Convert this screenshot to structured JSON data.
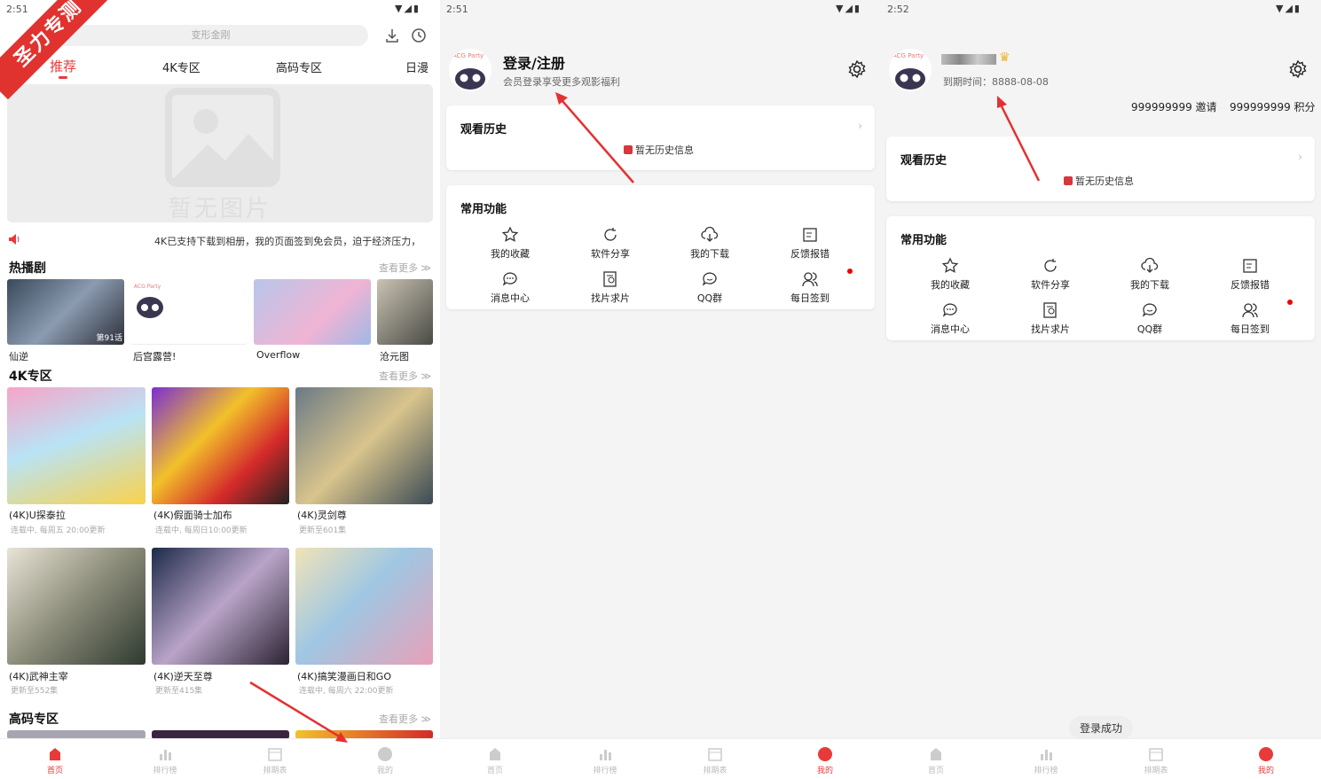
{
  "watermark": "圣力专测",
  "home": {
    "status_time": "2:51",
    "search_placeholder": "变形金刚",
    "tabs": [
      "推荐",
      "4K专区",
      "高码专区",
      "日漫"
    ],
    "banner_placeholder": "暂无图片",
    "notice": "4K已支持下载到相册，我的页面签到免会员，迫于经济压力，",
    "hot": {
      "title": "热播剧",
      "more": "查看更多",
      "items": [
        {
          "title": "仙逆",
          "badge": "第91话"
        },
        {
          "title": "后宫露营!",
          "badge": ""
        },
        {
          "title": "Overflow",
          "badge": ""
        },
        {
          "title": "沧元图",
          "badge": ""
        }
      ]
    },
    "k4": {
      "title": "4K专区",
      "more": "查看更多",
      "items": [
        {
          "title": "(4K)U探泰拉",
          "sub": "连载中, 每周五 20:00更新"
        },
        {
          "title": "(4K)假面骑士加布",
          "sub": "连载中, 每周日10:00更新"
        },
        {
          "title": "(4K)灵剑尊",
          "sub": "更新至601集"
        },
        {
          "title": "(4K)武神主宰",
          "sub": "更新至552集"
        },
        {
          "title": "(4K)逆天至尊",
          "sub": "更新至415集"
        },
        {
          "title": "(4K)搞笑漫画日和GO",
          "sub": "连载中, 每周六 22:00更新"
        }
      ]
    },
    "hq": {
      "title": "高码专区",
      "more": "查看更多"
    }
  },
  "tabbar": [
    "首页",
    "排行榜",
    "排期表",
    "我的"
  ],
  "profile_guest": {
    "status_time": "2:51",
    "name": "登录/注册",
    "subtitle": "会员登录享受更多观影福利",
    "history_title": "观看历史",
    "history_empty": "暂无历史信息",
    "functions_title": "常用功能",
    "functions": [
      "我的收藏",
      "软件分享",
      "我的下载",
      "反馈报错",
      "消息中心",
      "找片求片",
      "QQ群",
      "每日签到"
    ]
  },
  "profile_user": {
    "status_time": "2:52",
    "expiry": "到期时间：8888-08-08",
    "invites": "999999999 邀请",
    "points": "999999999 积分",
    "history_title": "观看历史",
    "history_empty": "暂无历史信息",
    "functions_title": "常用功能",
    "functions": [
      "我的收藏",
      "软件分享",
      "我的下载",
      "反馈报错",
      "消息中心",
      "找片求片",
      "QQ群",
      "每日签到"
    ],
    "toast": "登录成功"
  },
  "colors": {
    "accent": "#e83a3a",
    "bg": "#f4f4f4"
  }
}
